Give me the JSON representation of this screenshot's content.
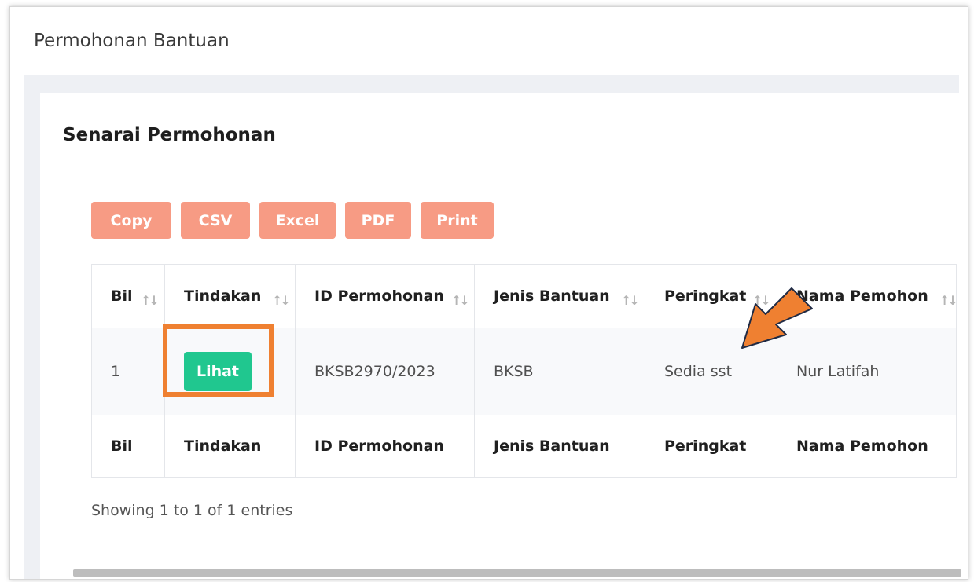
{
  "page": {
    "title": "Permohonan Bantuan"
  },
  "card": {
    "title": "Senarai Permohonan"
  },
  "export_buttons": [
    "Copy",
    "CSV",
    "Excel",
    "PDF",
    "Print"
  ],
  "table": {
    "columns": [
      "Bil",
      "Tindakan",
      "ID Permohonan",
      "Jenis Bantuan",
      "Peringkat",
      "Nama Pemohon"
    ],
    "rows": [
      {
        "bil": "1",
        "action": "Lihat",
        "id": "BKSB2970/2023",
        "jenis": "BKSB",
        "peringkat": "Sedia sst",
        "nama": "Nur Latifah"
      }
    ],
    "sort_glyph": "↑↓"
  },
  "info": "Showing 1 to 1 of 1 entries",
  "colors": {
    "export_button": "#f79b84",
    "lihat_button": "#20c78f",
    "annotation": "#ef8031"
  },
  "annotations": {
    "highlight": "orange box around Lihat button",
    "arrow": "orange arrow pointing at Peringkat value"
  }
}
